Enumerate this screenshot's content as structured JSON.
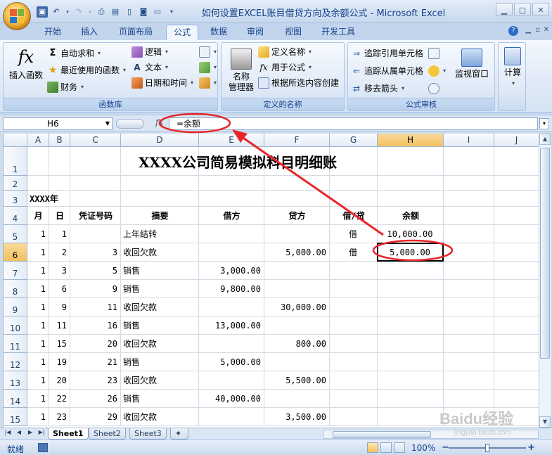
{
  "window": {
    "title": "如何设置EXCEL账目借贷方向及余额公式 - Microsoft Excel"
  },
  "tabs": [
    "开始",
    "插入",
    "页面布局",
    "公式",
    "数据",
    "审阅",
    "视图",
    "开发工具"
  ],
  "ribbon": {
    "function_library": {
      "label": "函数库",
      "insert_function": "插入函数",
      "autosum": "自动求和",
      "recent": "最近使用的函数",
      "financial": "财务",
      "logical": "逻辑",
      "text": "文本",
      "datetime": "日期和时间"
    },
    "defined_names": {
      "label": "定义的名称",
      "name_manager_line1": "名称",
      "name_manager_line2": "管理器",
      "define_name": "定义名称",
      "use_in_formula": "用于公式",
      "create_from_selection": "根据所选内容创建"
    },
    "formula_auditing": {
      "label": "公式审核",
      "trace_precedents": "追踪引用单元格",
      "trace_dependents": "追踪从属单元格",
      "remove_arrows": "移去箭头",
      "watch_window": "监视窗口"
    },
    "calculation": {
      "label": "计算"
    }
  },
  "formula_bar": {
    "name_box": "H6",
    "fx": "fx",
    "formula": "=余额"
  },
  "sheet": {
    "columns": [
      "A",
      "B",
      "C",
      "D",
      "E",
      "F",
      "G",
      "H",
      "I",
      "J"
    ],
    "rows": [
      "1",
      "2",
      "3",
      "4",
      "5",
      "6",
      "7",
      "8",
      "9",
      "10",
      "11",
      "12",
      "13",
      "14",
      "15"
    ],
    "title": "XXXX公司简易模拟科目明细账",
    "year_label": "XXXX年",
    "headers": {
      "month": "月",
      "day": "日",
      "voucher": "凭证号码",
      "summary": "摘要",
      "debit": "借方",
      "credit": "贷方",
      "direction": "借/贷",
      "balance": "余额"
    },
    "data": [
      {
        "month": "1",
        "day": "1",
        "voucher": "",
        "summary": "上年结转",
        "debit": "",
        "credit": "",
        "direction": "借",
        "balance": "10,000.00"
      },
      {
        "month": "1",
        "day": "2",
        "voucher": "3",
        "summary": "收回欠款",
        "debit": "",
        "credit": "5,000.00",
        "direction": "借",
        "balance": "5,000.00"
      },
      {
        "month": "1",
        "day": "3",
        "voucher": "5",
        "summary": "销售",
        "debit": "3,000.00",
        "credit": "",
        "direction": "",
        "balance": ""
      },
      {
        "month": "1",
        "day": "6",
        "voucher": "9",
        "summary": "销售",
        "debit": "9,800.00",
        "credit": "",
        "direction": "",
        "balance": ""
      },
      {
        "month": "1",
        "day": "9",
        "voucher": "11",
        "summary": "收回欠款",
        "debit": "",
        "credit": "30,000.00",
        "direction": "",
        "balance": ""
      },
      {
        "month": "1",
        "day": "11",
        "voucher": "16",
        "summary": "销售",
        "debit": "13,000.00",
        "credit": "",
        "direction": "",
        "balance": ""
      },
      {
        "month": "1",
        "day": "15",
        "voucher": "20",
        "summary": "收回欠款",
        "debit": "",
        "credit": "800.00",
        "direction": "",
        "balance": ""
      },
      {
        "month": "1",
        "day": "19",
        "voucher": "21",
        "summary": "销售",
        "debit": "5,000.00",
        "credit": "",
        "direction": "",
        "balance": ""
      },
      {
        "month": "1",
        "day": "20",
        "voucher": "23",
        "summary": "收回欠款",
        "debit": "",
        "credit": "5,500.00",
        "direction": "",
        "balance": ""
      },
      {
        "month": "1",
        "day": "22",
        "voucher": "26",
        "summary": "销售",
        "debit": "40,000.00",
        "credit": "",
        "direction": "",
        "balance": ""
      },
      {
        "month": "1",
        "day": "23",
        "voucher": "29",
        "summary": "收回欠款",
        "debit": "",
        "credit": "3,500.00",
        "direction": "",
        "balance": ""
      }
    ]
  },
  "sheet_tabs": [
    "Sheet1",
    "Sheet2",
    "Sheet3"
  ],
  "status": {
    "ready": "就绪",
    "zoom": "100%"
  },
  "watermark": "Baidu经验 jingyan.baidu.com",
  "colors": {
    "annotation": "#e8262a"
  }
}
